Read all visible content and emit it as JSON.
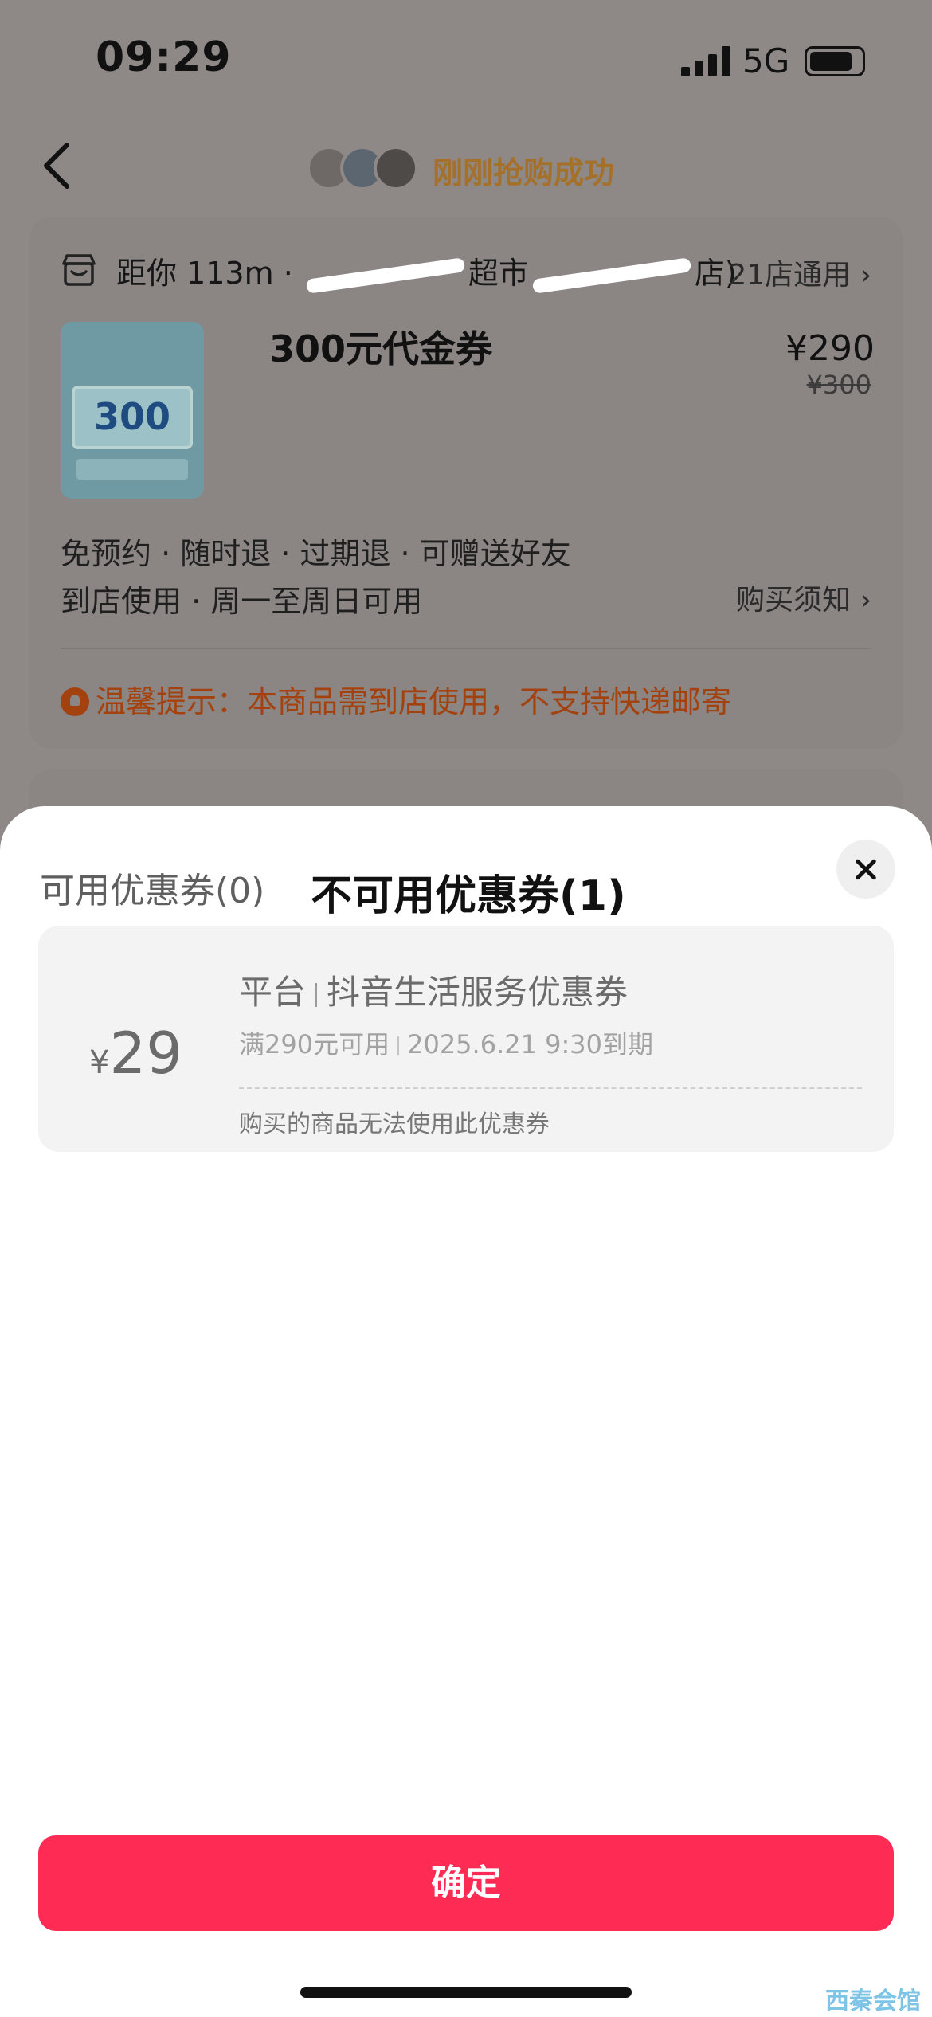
{
  "status_bar": {
    "time": "09:29",
    "network": "5G",
    "icons": [
      "cellular-signal-icon",
      "battery-icon"
    ]
  },
  "header": {
    "avatars": [
      "avatar-1",
      "avatar-2",
      "avatar-3"
    ],
    "success_text": "刚刚抢购成功",
    "accent_color": "#a5702a"
  },
  "product": {
    "store_distance": "距你 113m · ",
    "store_name_partial": "超市",
    "store_suffix": "店)",
    "shops_label": "21店通用",
    "thumb_text": "300",
    "name": "300元代金券",
    "price": "¥290",
    "original_price": "¥300",
    "tags_line1": "免预约 · 随时退 · 过期退 · 可赠送好友",
    "tags_line2": "到店使用 · 周一至周日可用",
    "notice_link": "购买须知",
    "tip": "温馨提示：本商品需到店使用，不支持快递邮寄",
    "tip_color": "#a3420f"
  },
  "sheet": {
    "tab_available": "可用优惠券(0)",
    "tab_unavailable": "不可用优惠券(1)",
    "coupon": {
      "currency": "¥",
      "amount": "29",
      "source": "平台",
      "title": "抖音生活服务优惠券",
      "condition": "满290元可用",
      "expiry": "2025.6.21 9:30到期",
      "reason": "购买的商品无法使用此优惠券"
    },
    "confirm_label": "确定",
    "confirm_color": "#fe2c55"
  },
  "watermark": "西秦会馆"
}
